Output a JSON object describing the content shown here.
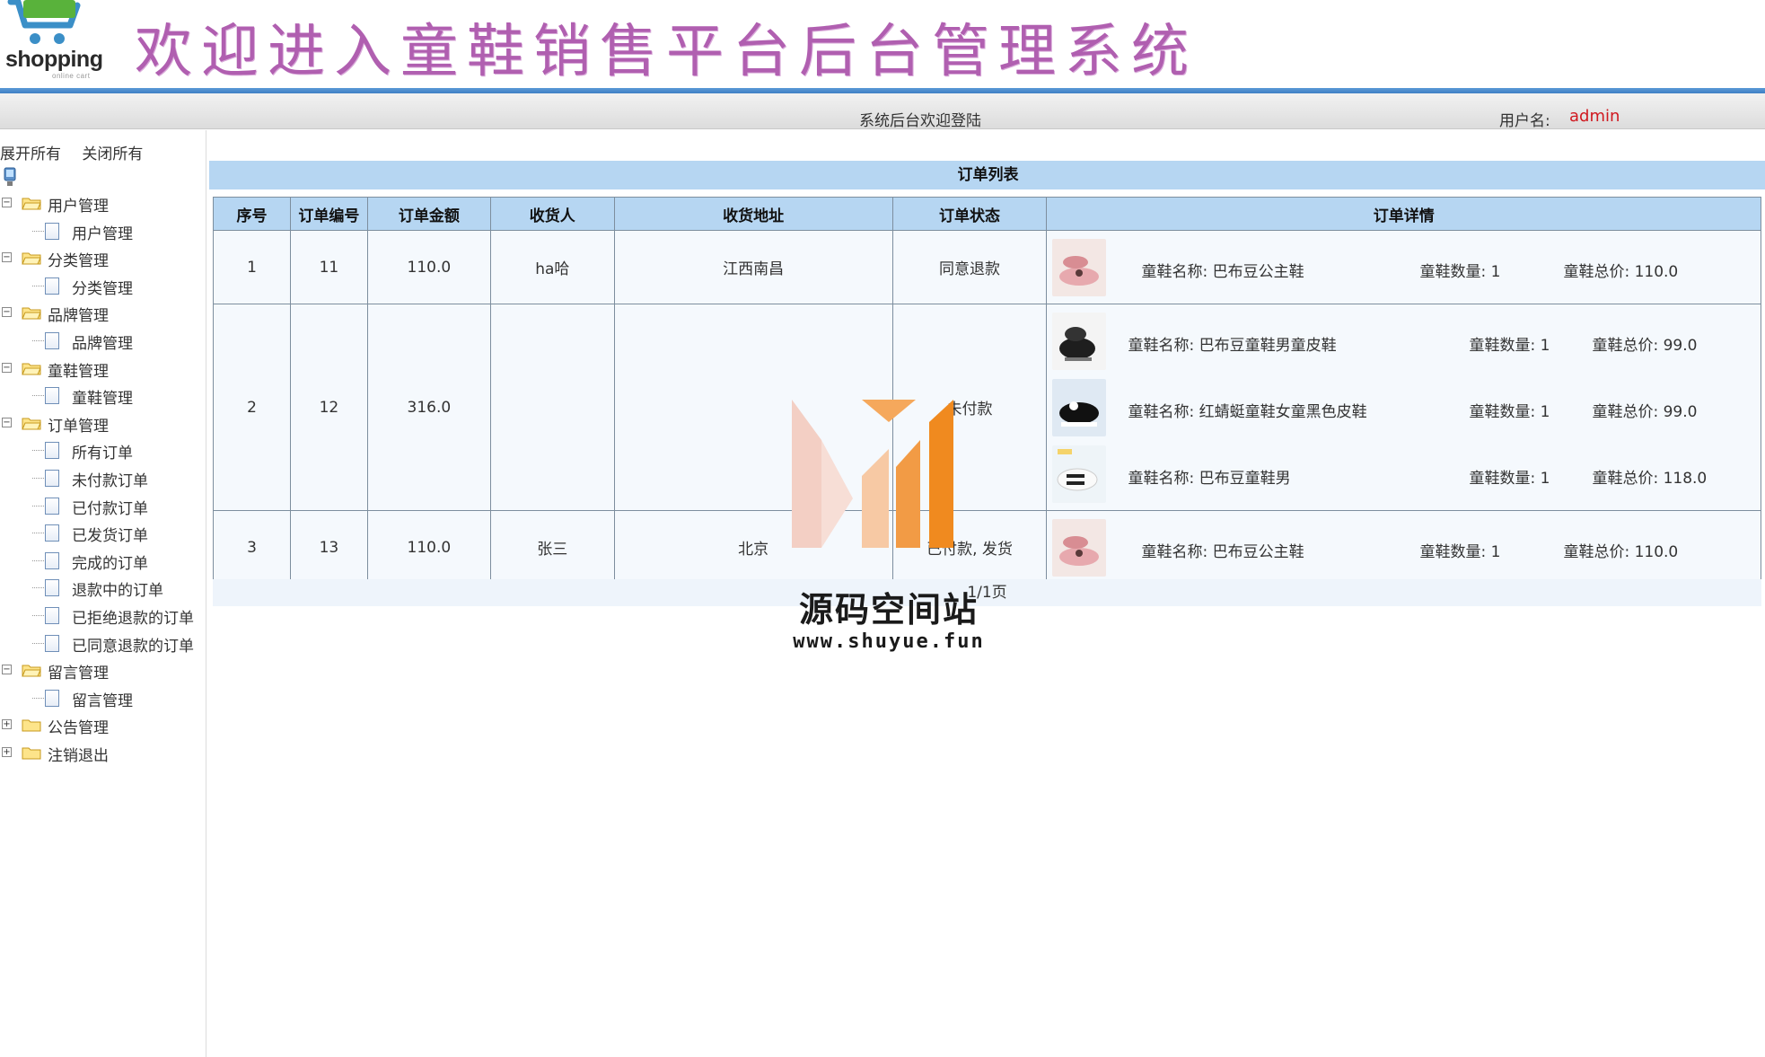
{
  "header": {
    "logo_text": "shopping",
    "logo_sub": "online cart",
    "title": "欢迎进入童鞋销售平台后台管理系统"
  },
  "status_bar": {
    "welcome": "系统后台欢迎登陆",
    "user_label": "用户名:",
    "user_name": "admin"
  },
  "sidebar": {
    "expand_all": "展开所有",
    "collapse_all": "关闭所有",
    "groups": [
      {
        "label": "用户管理",
        "expanded": true,
        "items": [
          "用户管理"
        ]
      },
      {
        "label": "分类管理",
        "expanded": true,
        "items": [
          "分类管理"
        ]
      },
      {
        "label": "品牌管理",
        "expanded": true,
        "items": [
          "品牌管理"
        ]
      },
      {
        "label": "童鞋管理",
        "expanded": true,
        "items": [
          "童鞋管理"
        ]
      },
      {
        "label": "订单管理",
        "expanded": true,
        "items": [
          "所有订单",
          "未付款订单",
          "已付款订单",
          "已发货订单",
          "完成的订单",
          "退款中的订单",
          "已拒绝退款的订单",
          "已同意退款的订单"
        ]
      },
      {
        "label": "留言管理",
        "expanded": true,
        "items": [
          "留言管理"
        ]
      },
      {
        "label": "公告管理",
        "expanded": false,
        "items": []
      },
      {
        "label": "注销退出",
        "expanded": false,
        "items": []
      }
    ]
  },
  "main": {
    "caption": "订单列表",
    "columns": [
      "序号",
      "订单编号",
      "订单金额",
      "收货人",
      "收货地址",
      "订单状态",
      "订单详情"
    ],
    "rows": [
      {
        "index": "1",
        "order_no": "11",
        "amount": "110.0",
        "receiver": "ha哈",
        "address": "江西南昌",
        "status": "同意退款",
        "details": [
          {
            "name": "童鞋名称: 巴布豆公主鞋",
            "qty": "童鞋数量: 1",
            "total": "童鞋总价: 110.0",
            "thumb": "pink-shoe"
          }
        ]
      },
      {
        "index": "2",
        "order_no": "12",
        "amount": "316.0",
        "receiver": "",
        "address": "",
        "status": "未付款",
        "details": [
          {
            "name": "童鞋名称: 巴布豆童鞋男童皮鞋",
            "qty": "童鞋数量: 1",
            "total": "童鞋总价: 99.0",
            "thumb": "black-shoe"
          },
          {
            "name": "童鞋名称: 红蜻蜓童鞋女童黑色皮鞋",
            "qty": "童鞋数量: 1",
            "total": "童鞋总价: 99.0",
            "thumb": "black-shoe-girl"
          },
          {
            "name": "童鞋名称: 巴布豆童鞋男",
            "qty": "童鞋数量: 1",
            "total": "童鞋总价: 118.0",
            "thumb": "white-sneaker"
          }
        ]
      },
      {
        "index": "3",
        "order_no": "13",
        "amount": "110.0",
        "receiver": "张三",
        "address": "北京",
        "status": "已付款, 发货",
        "details": [
          {
            "name": "童鞋名称: 巴布豆公主鞋",
            "qty": "童鞋数量: 1",
            "total": "童鞋总价: 110.0",
            "thumb": "pink-shoe"
          }
        ]
      }
    ],
    "pager": "1/1页"
  },
  "watermark": {
    "text": "源码空间站",
    "url": "www.shuyue.fun"
  },
  "colors": {
    "title_purple": "#b05fb0",
    "header_blue": "#4a8bd0",
    "table_header": "#b6d6f2",
    "user_red": "#d0181f"
  }
}
